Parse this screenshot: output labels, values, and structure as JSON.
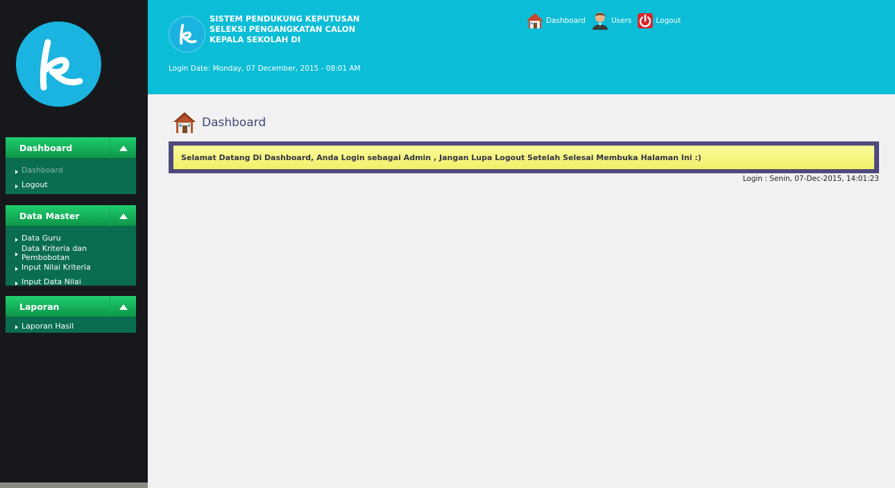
{
  "header": {
    "title": "SISTEM PENDUKUNG KEPUTUSAN SELEKSI PENGANGKATAN CALON KEPALA SEKOLAH DI",
    "login_date": "Login Date: Monday, 07 December, 2015 - 08:01 AM",
    "nav": [
      {
        "label": "Dashboard",
        "icon": "house-icon"
      },
      {
        "label": "Users",
        "icon": "user-icon"
      },
      {
        "label": "Logout",
        "icon": "power-icon"
      }
    ]
  },
  "logo": {
    "letter": "k",
    "color": "#1bb4e0"
  },
  "sidebar": {
    "sections": [
      {
        "title": "Dashboard",
        "items": [
          {
            "label": "Dashboard",
            "active": true
          },
          {
            "label": "Logout"
          }
        ]
      },
      {
        "title": "Data Master",
        "items": [
          {
            "label": "Data Guru"
          },
          {
            "label": "Data Kriteria dan Pembobotan"
          },
          {
            "label": "Input Nilai Kriteria"
          },
          {
            "label": "Input Data Nilai"
          }
        ]
      },
      {
        "title": "Laporan",
        "items": [
          {
            "label": "Laporan Hasil"
          }
        ]
      }
    ]
  },
  "main": {
    "page_title": "Dashboard",
    "welcome_message": "Selamat Datang Di Dashboard, Anda Login sebagai Admin , Jangan Lupa Logout Setelah Selesai Membuka Halaman Ini :)",
    "login_info": "Login : Senin, 07-Dec-2015, 14:01:23"
  },
  "colors": {
    "header_bg": "#0bbdd6",
    "sidebar_bg": "#17181c",
    "menu_head": "#17b45c",
    "menu_body": "#0a6d52",
    "welcome_border": "#4e4a7d",
    "welcome_bg": "#f4f37a"
  }
}
